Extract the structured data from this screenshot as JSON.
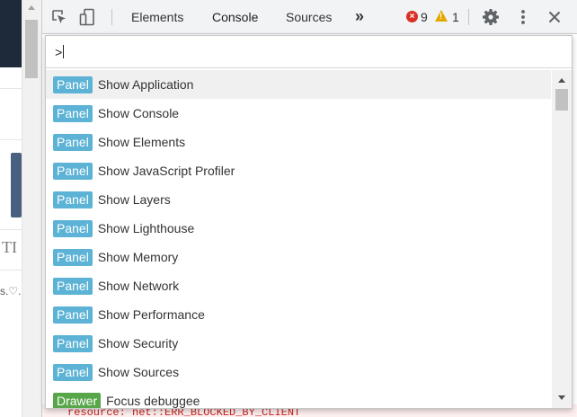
{
  "devtools": {
    "tabs": [
      {
        "label": "Elements",
        "selected": false
      },
      {
        "label": "Console",
        "selected": true
      },
      {
        "label": "Sources",
        "selected": false
      }
    ],
    "more_tabs": "»",
    "error_count": "9",
    "warning_count": "1",
    "icons": {
      "inspect": "inspect-element-icon",
      "device": "device-toolbar-icon",
      "error": "error-icon",
      "warning": "warning-icon",
      "settings": "gear-icon",
      "menu": "kebab-menu-icon",
      "close": "close-icon"
    }
  },
  "command_palette": {
    "prompt": ">",
    "items": [
      {
        "badge": "Panel",
        "label": "Show Application",
        "selected": true
      },
      {
        "badge": "Panel",
        "label": "Show Console",
        "selected": false
      },
      {
        "badge": "Panel",
        "label": "Show Elements",
        "selected": false
      },
      {
        "badge": "Panel",
        "label": "Show JavaScript Profiler",
        "selected": false
      },
      {
        "badge": "Panel",
        "label": "Show Layers",
        "selected": false
      },
      {
        "badge": "Panel",
        "label": "Show Lighthouse",
        "selected": false
      },
      {
        "badge": "Panel",
        "label": "Show Memory",
        "selected": false
      },
      {
        "badge": "Panel",
        "label": "Show Network",
        "selected": false
      },
      {
        "badge": "Panel",
        "label": "Show Performance",
        "selected": false
      },
      {
        "badge": "Panel",
        "label": "Show Security",
        "selected": false
      },
      {
        "badge": "Panel",
        "label": "Show Sources",
        "selected": false
      },
      {
        "badge": "Drawer",
        "label": "Focus debuggee",
        "selected": false
      }
    ]
  },
  "console": {
    "partial_error": "resource: net::ERR_BLOCKED_BY_CLIENT"
  },
  "background_page": {
    "text_ti": "TI",
    "text_heart": "s.♡."
  },
  "colors": {
    "panel_badge": "#5cb3d6",
    "drawer_badge": "#57a64a",
    "error": "#d93025",
    "warning": "#e3a800"
  }
}
